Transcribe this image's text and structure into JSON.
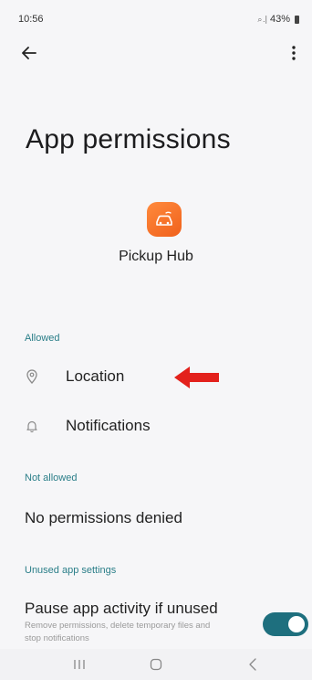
{
  "status": {
    "time": "10:56",
    "signal": "⌕ .∣",
    "battery": "43%"
  },
  "toolbar": {
    "back_icon": "arrow-left-icon",
    "menu_icon": "more-vert-icon"
  },
  "title": "App permissions",
  "app": {
    "name": "Pickup Hub",
    "icon": "car-icon",
    "icon_color": "#f26a21"
  },
  "sections": {
    "allowed": {
      "header": "Allowed",
      "items": [
        {
          "label": "Location",
          "icon": "location-pin-icon"
        },
        {
          "label": "Notifications",
          "icon": "bell-icon"
        }
      ]
    },
    "not_allowed": {
      "header": "Not allowed",
      "empty_text": "No permissions denied"
    },
    "unused": {
      "header": "Unused app settings",
      "pause_title": "Pause app activity if unused",
      "pause_subtitle": "Remove permissions, delete temporary files and stop notifications",
      "toggle_on": true
    }
  },
  "annotation": {
    "icon": "red-arrow-icon",
    "color": "#e3211c"
  },
  "nav": {
    "recent_icon": "recent-apps-icon",
    "home_icon": "home-icon",
    "back_icon": "nav-back-icon"
  },
  "colors": {
    "accent": "#2a7e88",
    "toggle": "#1e6f7e"
  }
}
